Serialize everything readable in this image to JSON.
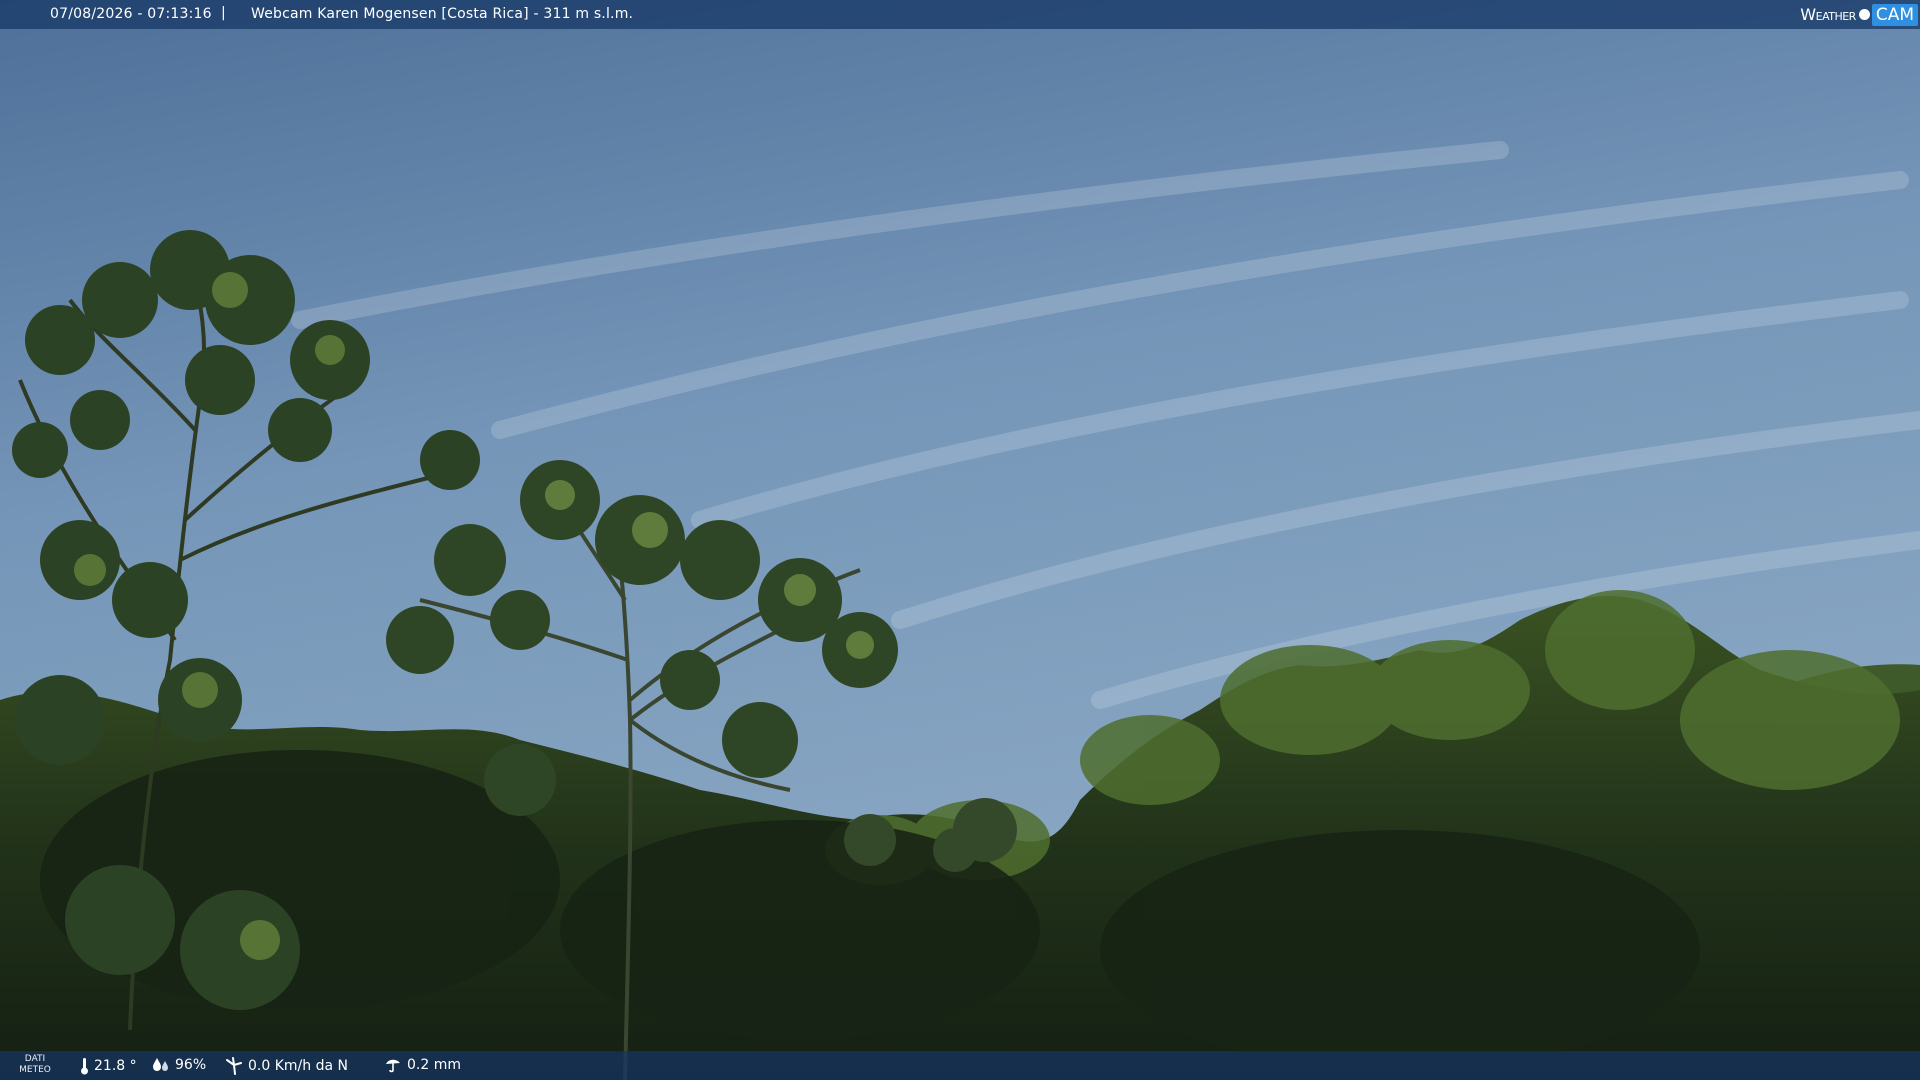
{
  "header": {
    "datetime": "07/08/2026 - 07:13:16",
    "separator": "|",
    "title": "Webcam Karen Mogensen [Costa Rica]  - 311 m s.l.m.",
    "logo": {
      "weather": "Weather",
      "cam": "CAM"
    }
  },
  "footer": {
    "label_line1": "DATI",
    "label_line2": "METEO",
    "temperature": "21.8 °",
    "humidity": "96%",
    "wind": "0.0 Km/h da N",
    "rain": "0.2 mm"
  },
  "colors": {
    "bar_bg": "#183a68",
    "logo_accent": "#2f8fe0",
    "sky_top": "#4d6f96",
    "sky_bottom": "#88a6c4",
    "foliage_dark": "#1f2f17",
    "foliage_light": "#5e7a35"
  }
}
